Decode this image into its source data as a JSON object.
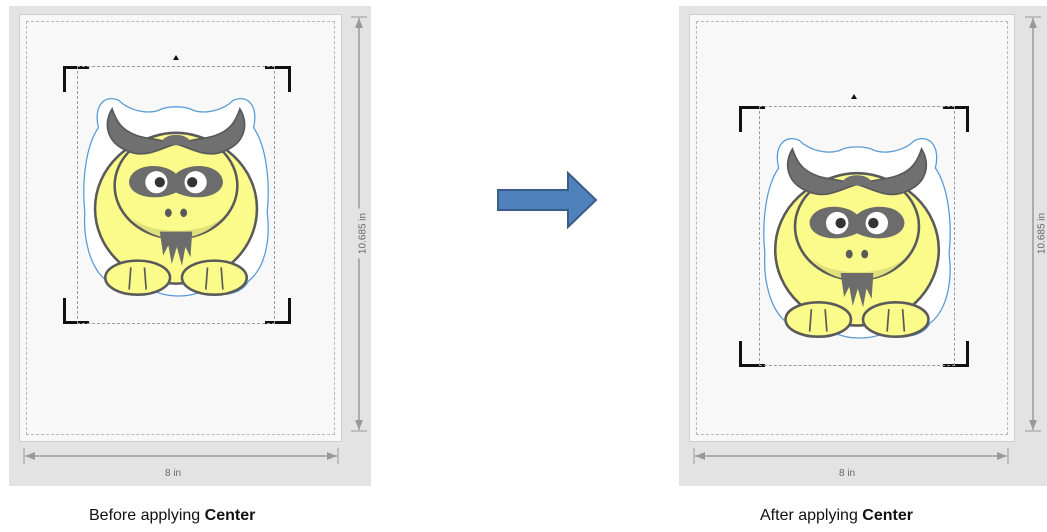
{
  "before": {
    "width_label": "8 in",
    "height_label": "10.685 in",
    "caption_text": "Before applying ",
    "caption_bold": "Center"
  },
  "after": {
    "width_label": "8 in",
    "height_label": "10.685 in",
    "caption_text": "After applying ",
    "caption_bold": "Center"
  },
  "colors": {
    "arrow": "#4f81bd",
    "arrow_stroke": "#385d8a",
    "body": "#fbfb8c",
    "shade": "#e6e67c",
    "horns": "#707070",
    "outline": "#5a5a5a",
    "contour": "#5b9bd5"
  }
}
